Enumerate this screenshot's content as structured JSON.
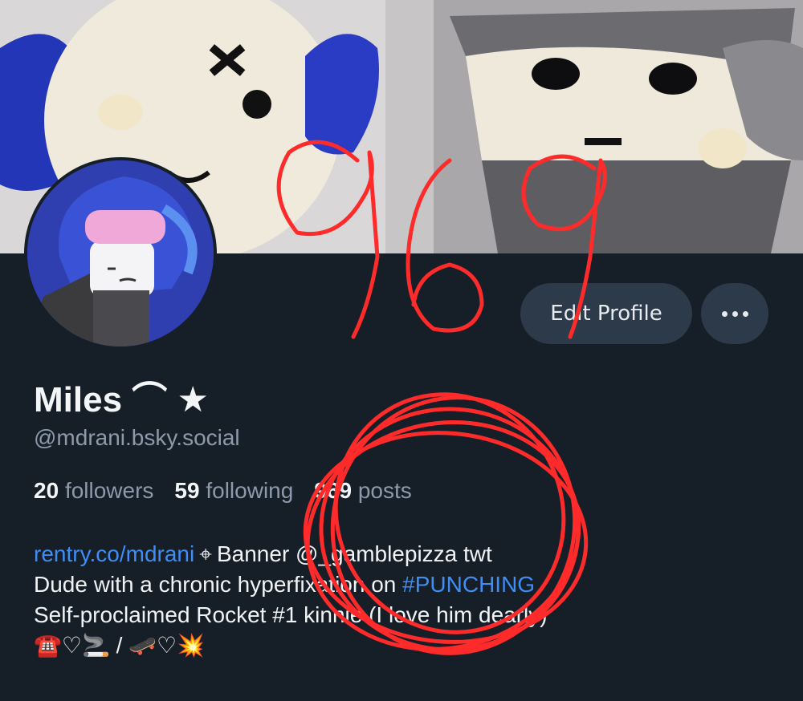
{
  "profile": {
    "display_name": "Miles ⌒ ★",
    "handle": "@mdrani.bsky.social"
  },
  "actions": {
    "edit_profile": "Edit Profile",
    "more": "more-options"
  },
  "stats": {
    "followers_count": "20",
    "followers_label": "followers",
    "following_count": "59",
    "following_label": "following",
    "posts_count": "969",
    "posts_label": "posts"
  },
  "bio": {
    "link": "rentry.co/mdrani",
    "separator": "⌖",
    "line1_rest": "Banner @_gamblepizza twt",
    "line2_text": "Dude with a chronic hyperfixation on ",
    "line2_tag": "#PUNCHING",
    "line3": "Self-proclaimed Rocket #1 kinnie (I love him dearly)",
    "line4": "☎️♡🚬 / 🛹♡💥"
  },
  "annotation": {
    "scribbled_number": "969"
  },
  "colors": {
    "background": "#161e27",
    "button_bg": "#2d3a49",
    "link": "#3e8ef5",
    "muted_text": "#8c9aab",
    "scribble": "#ff2b2b"
  },
  "icons": {
    "more": "ellipsis-icon",
    "separator": "crosshair-icon"
  }
}
